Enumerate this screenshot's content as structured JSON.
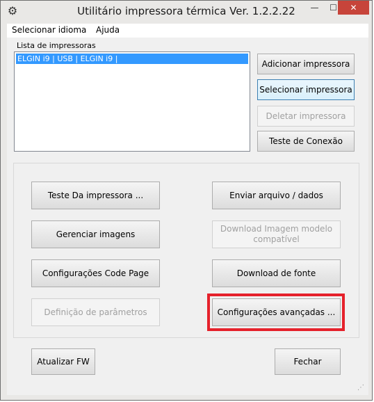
{
  "window": {
    "title": "Utilitário impressora térmica Ver. 1.2.2.22",
    "min_glyph": "—",
    "max_glyph": "☐",
    "close_glyph": "✕"
  },
  "menu": {
    "items": [
      "Selecionar idioma",
      "Ajuda"
    ]
  },
  "printers": {
    "label": "Lista de impressoras",
    "items": [
      "ELGIN i9 | USB | ELGIN i9 |"
    ]
  },
  "side_buttons": {
    "add": "Adicionar impressora",
    "select": "Selecionar impressora",
    "delete": "Deletar impressora",
    "test_connection": "Teste de Conexão"
  },
  "group_buttons": {
    "test_printer": "Teste Da impressora ...",
    "send_file": "Enviar arquivo / dados",
    "manage_images": "Gerenciar imagens",
    "download_template": "Download Imagem modelo compatível",
    "code_page": "Configurações Code Page",
    "download_font": "Download de fonte",
    "parameters": "Definição de parâmetros",
    "advanced": "Configurações avançadas ..."
  },
  "footer": {
    "update_fw": "Atualizar FW",
    "close": "Fechar"
  },
  "colors": {
    "highlight": "#e5212b",
    "selection": "#3399ff",
    "close_button": "#c7443a"
  },
  "icons": {
    "app": "gear-icon",
    "grip": "resize-grip-icon"
  }
}
